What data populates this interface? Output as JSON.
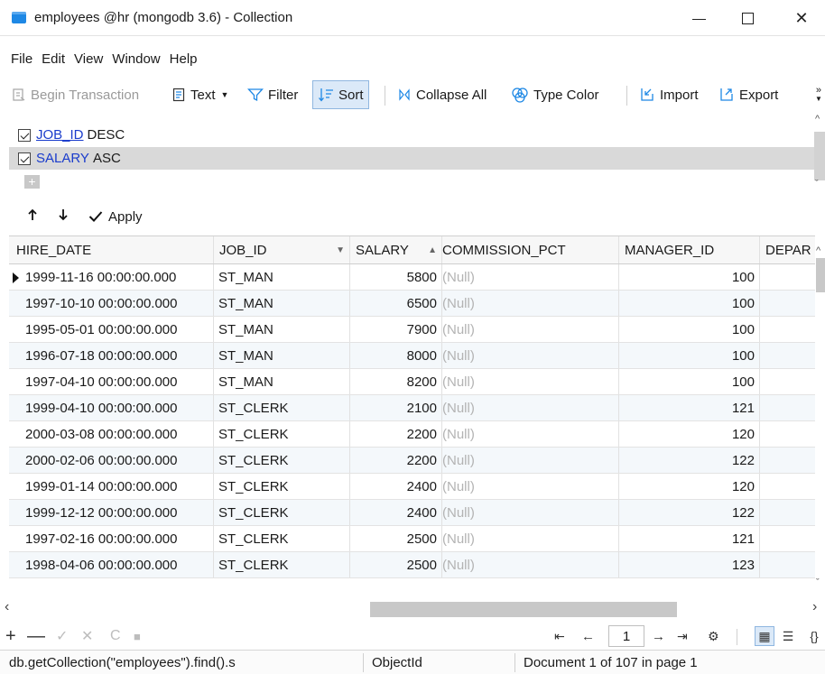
{
  "window": {
    "title": "employees @hr (mongodb 3.6) - Collection",
    "min_glyph": "—",
    "max_glyph": "☐",
    "close_glyph": "✕"
  },
  "menu": [
    "File",
    "Edit",
    "View",
    "Window",
    "Help"
  ],
  "toolbar": {
    "begin_transaction": "Begin Transaction",
    "text": "Text",
    "filter": "Filter",
    "sort": "Sort",
    "collapse_all": "Collapse All",
    "type_color": "Type Color",
    "import": "Import",
    "export": "Export"
  },
  "sort_rules": [
    {
      "field": "JOB_ID",
      "direction": "DESC",
      "checked": true
    },
    {
      "field": "SALARY",
      "direction": "ASC",
      "checked": true
    }
  ],
  "sort_add": "+",
  "apply_label": "Apply",
  "grid": {
    "columns": [
      "HIRE_DATE",
      "JOB_ID",
      "SALARY",
      "COMMISSION_PCT",
      "MANAGER_ID",
      "DEPAR"
    ],
    "null_label": "(Null)",
    "rows": [
      {
        "hire_date": "1999-11-16 00:00:00.000",
        "job_id": "ST_MAN",
        "salary": "5800",
        "manager_id": "100"
      },
      {
        "hire_date": "1997-10-10 00:00:00.000",
        "job_id": "ST_MAN",
        "salary": "6500",
        "manager_id": "100"
      },
      {
        "hire_date": "1995-05-01 00:00:00.000",
        "job_id": "ST_MAN",
        "salary": "7900",
        "manager_id": "100"
      },
      {
        "hire_date": "1996-07-18 00:00:00.000",
        "job_id": "ST_MAN",
        "salary": "8000",
        "manager_id": "100"
      },
      {
        "hire_date": "1997-04-10 00:00:00.000",
        "job_id": "ST_MAN",
        "salary": "8200",
        "manager_id": "100"
      },
      {
        "hire_date": "1999-04-10 00:00:00.000",
        "job_id": "ST_CLERK",
        "salary": "2100",
        "manager_id": "121"
      },
      {
        "hire_date": "2000-03-08 00:00:00.000",
        "job_id": "ST_CLERK",
        "salary": "2200",
        "manager_id": "120"
      },
      {
        "hire_date": "2000-02-06 00:00:00.000",
        "job_id": "ST_CLERK",
        "salary": "2200",
        "manager_id": "122"
      },
      {
        "hire_date": "1999-01-14 00:00:00.000",
        "job_id": "ST_CLERK",
        "salary": "2400",
        "manager_id": "120"
      },
      {
        "hire_date": "1999-12-12 00:00:00.000",
        "job_id": "ST_CLERK",
        "salary": "2400",
        "manager_id": "122"
      },
      {
        "hire_date": "1997-02-16 00:00:00.000",
        "job_id": "ST_CLERK",
        "salary": "2500",
        "manager_id": "121"
      },
      {
        "hire_date": "1998-04-06 00:00:00.000",
        "job_id": "ST_CLERK",
        "salary": "2500",
        "manager_id": "123"
      }
    ]
  },
  "pager": {
    "page": "1"
  },
  "status": {
    "query": "db.getCollection(\"employees\").find().s",
    "type": "ObjectId",
    "document": "Document 1 of 107 in page 1"
  },
  "colors": {
    "accent": "#1e88e5",
    "sort_field": "#1a3ccc",
    "null_text": "#b3b3b3",
    "selection": "#d9d9d9"
  }
}
